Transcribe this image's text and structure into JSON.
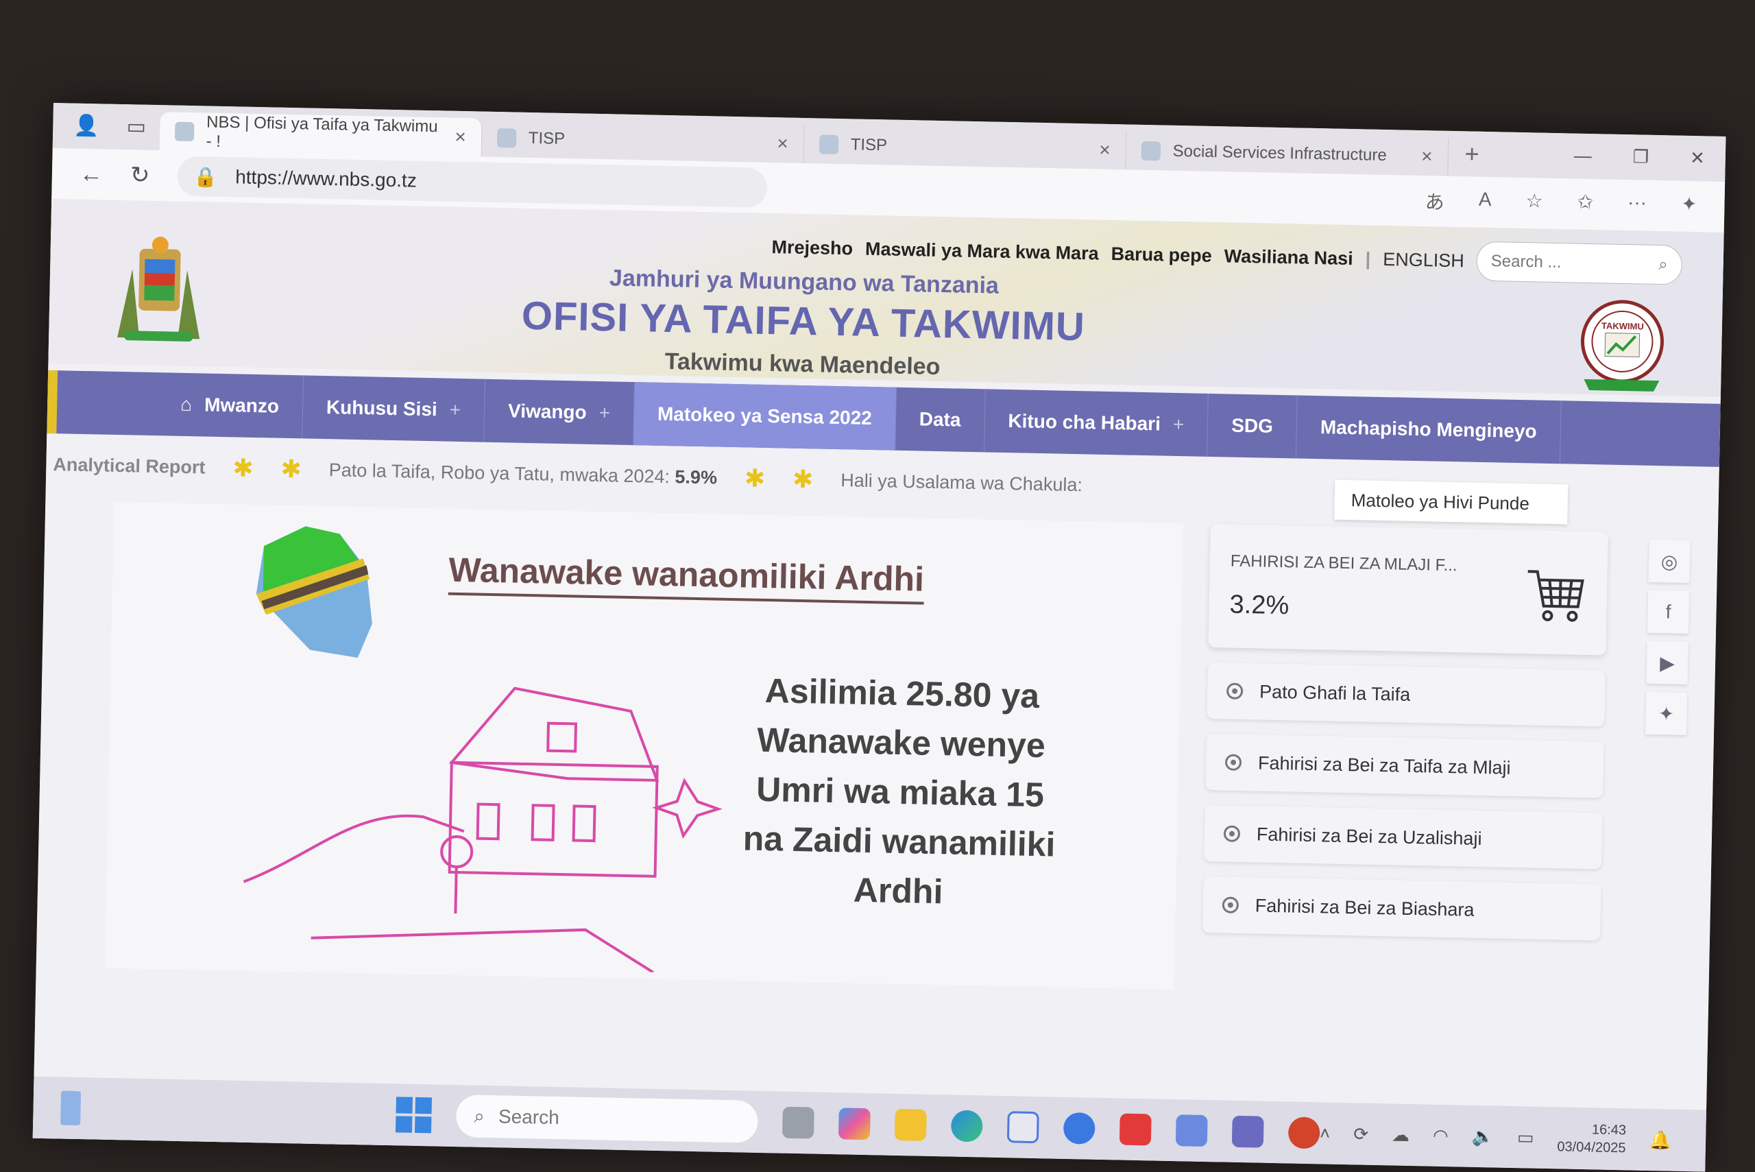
{
  "browser": {
    "tabs": [
      {
        "label": "NBS | Ofisi ya Taifa ya Takwimu - !",
        "active": true
      },
      {
        "label": "TISP",
        "active": false
      },
      {
        "label": "TISP",
        "active": false
      },
      {
        "label": "Social Services Infrastructure",
        "active": false
      }
    ],
    "url": "https://www.nbs.go.tz",
    "status_url": "https://www.nbs.go.tz/statistics/topic/census-2022"
  },
  "header": {
    "utility_links": [
      "Mrejesho",
      "Maswali ya Mara kwa Mara",
      "Barua pepe",
      "Wasiliana Nasi"
    ],
    "language": "ENGLISH",
    "search_placeholder": "Search ...",
    "republic": "Jamhuri ya Muungano wa Tanzania",
    "office": "OFISI YA TAIFA YA TAKWIMU",
    "motto": "Takwimu kwa Maendeleo",
    "logo_text": "TAKWIMU"
  },
  "nav": [
    {
      "label": "Mwanzo",
      "icon": "home-icon",
      "plus": false,
      "active": false
    },
    {
      "label": "Kuhusu Sisi",
      "plus": true,
      "active": false
    },
    {
      "label": "Viwango",
      "plus": true,
      "active": false
    },
    {
      "label": "Matokeo ya Sensa 2022",
      "plus": false,
      "active": true
    },
    {
      "label": "Data",
      "plus": false,
      "active": false
    },
    {
      "label": "Kituo cha Habari",
      "plus": true,
      "active": false
    },
    {
      "label": "SDG",
      "plus": false,
      "active": false
    },
    {
      "label": "Machapisho Mengineyo",
      "plus": false,
      "active": false
    }
  ],
  "ticker": {
    "item1": "Analytical Report",
    "item2": "Pato la Taifa, Robo ya Tatu, mwaka 2024:",
    "item2_value": "5.9%",
    "item3": "Hali ya Usalama wa Chakula:",
    "latest_label": "Matoleo ya Hivi Punde"
  },
  "banner": {
    "title": "Wanawake wanaomiliki Ardhi",
    "text": "Asilimia 25.80 ya Wanawake wenye Umri wa miaka 15 na Zaidi wanamiliki Ardhi"
  },
  "sidebar": {
    "cpi_title": "FAHIRISI ZA BEI ZA MLAJI F...",
    "cpi_value": "3.2%",
    "links": [
      "Pato Ghafi la Taifa",
      "Fahirisi za Bei za Taifa za Mlaji",
      "Fahirisi za Bei za Uzalishaji",
      "Fahirisi za Bei za Biashara"
    ]
  },
  "taskbar": {
    "search_placeholder": "Search",
    "time": "16:43",
    "date": "03/04/2025"
  },
  "colors": {
    "nav": "#6c6cb0",
    "nav_active": "#8a90dc",
    "accent": "#e8c31c",
    "title": "#6466b0"
  }
}
